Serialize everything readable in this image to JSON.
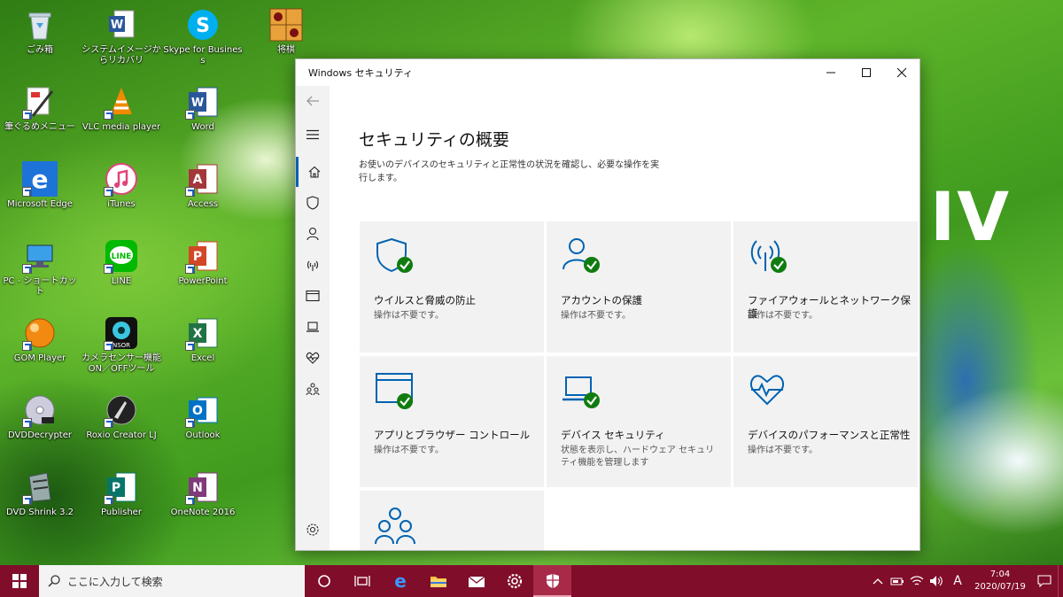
{
  "desktop": {
    "deco_text": "IV",
    "icons": [
      {
        "label": "ごみ箱",
        "icon": "recycle-bin-icon"
      },
      {
        "label": "システムイメージからリカバリ",
        "icon": "word-doc-icon"
      },
      {
        "label": "Skype for Business",
        "icon": "skype-icon"
      },
      {
        "label": "将棋",
        "icon": "shogi-icon"
      },
      {
        "label": "筆ぐるめメニュー",
        "icon": "fudegurume-icon"
      },
      {
        "label": "VLC media player",
        "icon": "vlc-icon"
      },
      {
        "label": "Word",
        "icon": "word-icon"
      },
      {
        "label": "Microsoft Edge",
        "icon": "edge-icon"
      },
      {
        "label": "iTunes",
        "icon": "itunes-icon"
      },
      {
        "label": "Access",
        "icon": "access-icon"
      },
      {
        "label": "PC - ショートカット",
        "icon": "pc-icon"
      },
      {
        "label": "LINE",
        "icon": "line-icon"
      },
      {
        "label": "PowerPoint",
        "icon": "powerpoint-icon"
      },
      {
        "label": "GOM Player",
        "icon": "gom-icon"
      },
      {
        "label": "カメラセンサー機能ON／OFFツール",
        "icon": "camera-sensor-icon"
      },
      {
        "label": "Excel",
        "icon": "excel-icon"
      },
      {
        "label": "DVDDecrypter",
        "icon": "dvd-icon"
      },
      {
        "label": "Roxio Creator LJ",
        "icon": "roxio-icon"
      },
      {
        "label": "Outlook",
        "icon": "outlook-icon"
      },
      {
        "label": "DVD Shrink 3.2",
        "icon": "dvdshrink-icon"
      },
      {
        "label": "Publisher",
        "icon": "publisher-icon"
      },
      {
        "label": "OneNote 2016",
        "icon": "onenote-icon"
      }
    ]
  },
  "window": {
    "title": "Windows セキュリティ",
    "page_title": "セキュリティの概要",
    "page_desc": "お使いのデバイスのセキュリティと正常性の状況を確認し、必要な操作を実行します。",
    "nav_icons": [
      "back-arrow-icon",
      "hamburger-icon",
      "home-icon",
      "shield-icon",
      "person-icon",
      "wifi-icon",
      "app-browser-icon",
      "laptop-icon",
      "heart-icon",
      "family-icon",
      "gear-icon"
    ],
    "cards": [
      {
        "title": "ウイルスと脅威の防止",
        "status": "操作は不要です。",
        "icon": "shield-check-icon"
      },
      {
        "title": "アカウントの保護",
        "status": "操作は不要です。",
        "icon": "account-check-icon"
      },
      {
        "title": "ファイアウォールとネットワーク保護",
        "status": "操作は不要です。",
        "icon": "network-check-icon"
      },
      {
        "title": "アプリとブラウザー コントロール",
        "status": "操作は不要です。",
        "icon": "app-browser-check-icon"
      },
      {
        "title": "デバイス セキュリティ",
        "status": "状態を表示し、ハードウェア セキュリティ機能を管理します",
        "icon": "laptop-check-icon"
      },
      {
        "title": "デバイスのパフォーマンスと正常性",
        "status": "操作は不要です。",
        "icon": "heart-pulse-icon"
      },
      {
        "title": "",
        "status": "",
        "icon": "family-options-icon"
      }
    ]
  },
  "taskbar": {
    "search_placeholder": "ここに入力して検索",
    "ime": "A",
    "time": "7:04",
    "date": "2020/07/19"
  },
  "colors": {
    "accent": "#0063b1",
    "check": "#107c10",
    "taskbar": "#800d2a"
  }
}
